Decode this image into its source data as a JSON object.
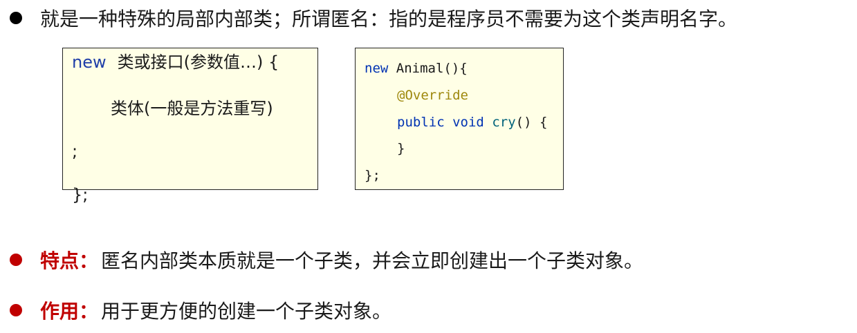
{
  "bullets": {
    "definition": "就是一种特殊的局部内部类；所谓匿名：指的是程序员不需要为这个类声明名字。",
    "feature_label": "特点：",
    "feature_text": "匿名内部类本质就是一个子类，并会立即创建出一个子类对象。",
    "usage_label": "作用：",
    "usage_text": "用于更方便的创建一个子类对象。"
  },
  "syntax_template": {
    "new_keyword": "new",
    "line1_rest": "类或接口(参数值…) {",
    "line2": "类体(一般是方法重写)",
    "line3": ";",
    "line4": "};"
  },
  "code_example": {
    "kw_new": "new",
    "line1_rest": " Animal(){",
    "annotation": "@Override",
    "kw_public": "public",
    "kw_void": "void",
    "method_name": "cry",
    "method_rest": "() {",
    "close_method": "}",
    "close_class": "};"
  },
  "colors": {
    "accent_red": "#c00000",
    "keyword_blue": "#0033b3",
    "annotation_olive": "#9e880d",
    "box_background": "#ffffe6"
  }
}
